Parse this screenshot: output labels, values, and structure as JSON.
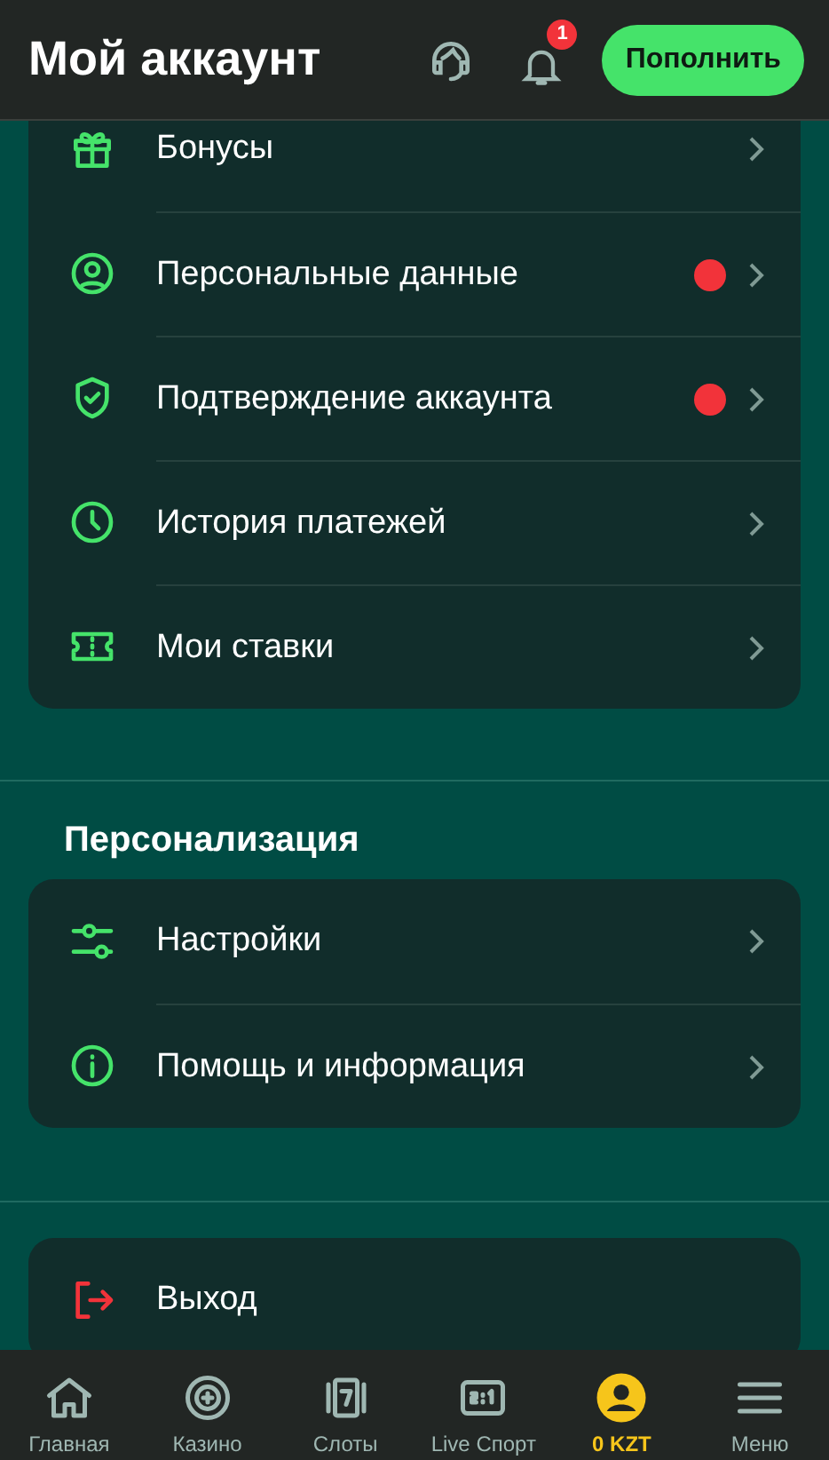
{
  "header": {
    "title": "Мой аккаунт",
    "notification_count": "1",
    "deposit_button": "Пополнить"
  },
  "account_items": [
    {
      "kind": "gift",
      "label": "Бонусы",
      "alert": false
    },
    {
      "kind": "user",
      "label": "Персональные данные",
      "alert": true
    },
    {
      "kind": "shield",
      "label": "Подтверждение аккаунта",
      "alert": true
    },
    {
      "kind": "clock",
      "label": "История платежей",
      "alert": false
    },
    {
      "kind": "ticket",
      "label": "Мои ставки",
      "alert": false
    }
  ],
  "personalization": {
    "title": "Персонализация",
    "items": [
      {
        "kind": "sliders",
        "label": "Настройки",
        "alert": false
      },
      {
        "kind": "info",
        "label": "Помощь и информация",
        "alert": false
      }
    ]
  },
  "logout": {
    "kind": "logout",
    "label": "Выход"
  },
  "bottom_nav": [
    {
      "kind": "home",
      "label": "Главная",
      "selected": false
    },
    {
      "kind": "casino",
      "label": "Казино",
      "selected": false
    },
    {
      "kind": "slots",
      "label": "Слоты",
      "selected": false
    },
    {
      "kind": "score",
      "label": "Live Спорт",
      "selected": false
    },
    {
      "kind": "account",
      "label": "0 KZT",
      "selected": true
    },
    {
      "kind": "menu",
      "label": "Меню",
      "selected": false
    }
  ]
}
